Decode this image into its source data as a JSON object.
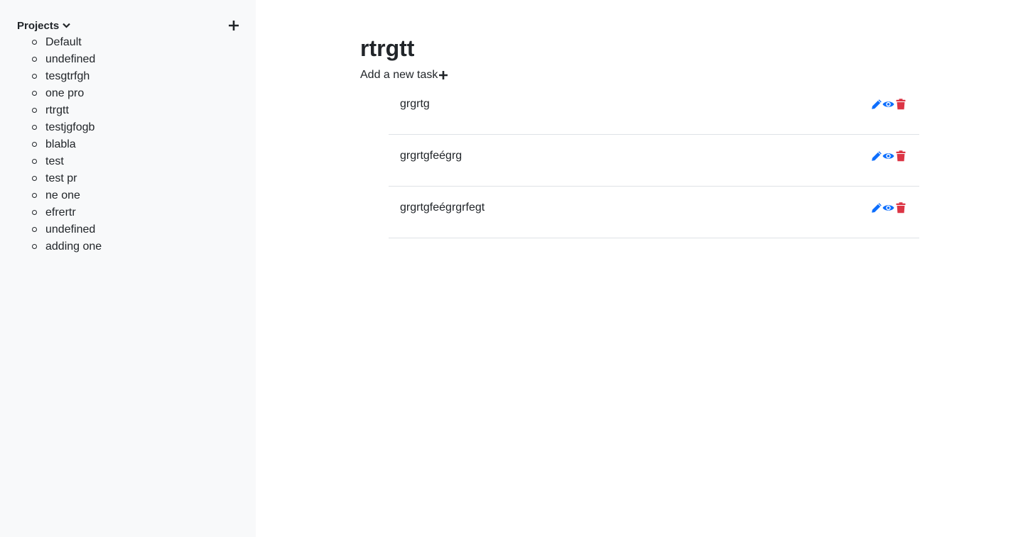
{
  "sidebar": {
    "header_label": "Projects",
    "icons": {
      "chevron": "chevron-down-icon",
      "add": "plus-icon"
    },
    "projects": [
      {
        "label": "Default"
      },
      {
        "label": "undefined"
      },
      {
        "label": "tesgtrfgh"
      },
      {
        "label": "one pro"
      },
      {
        "label": "rtrgtt"
      },
      {
        "label": "testjgfogb"
      },
      {
        "label": "blabla"
      },
      {
        "label": "test"
      },
      {
        "label": "test pr"
      },
      {
        "label": "ne one"
      },
      {
        "label": "efrertr"
      },
      {
        "label": "undefined"
      },
      {
        "label": "adding one"
      }
    ]
  },
  "main": {
    "title": "rtrgtt",
    "add_task_label": "Add a new task",
    "tasks": [
      {
        "name": "grgrtg"
      },
      {
        "name": "grgrtgfeégrg"
      },
      {
        "name": "grgrtgfeégrgrfegt"
      }
    ],
    "icons": {
      "edit": "pencil-icon",
      "view": "eye-icon",
      "delete": "trash-icon"
    }
  },
  "colors": {
    "sidebar_bg": "#f8f9fa",
    "text": "#212529",
    "edit_view_icon": "#0d6efd",
    "delete_icon": "#dc3545",
    "divider": "#dee2e6"
  }
}
